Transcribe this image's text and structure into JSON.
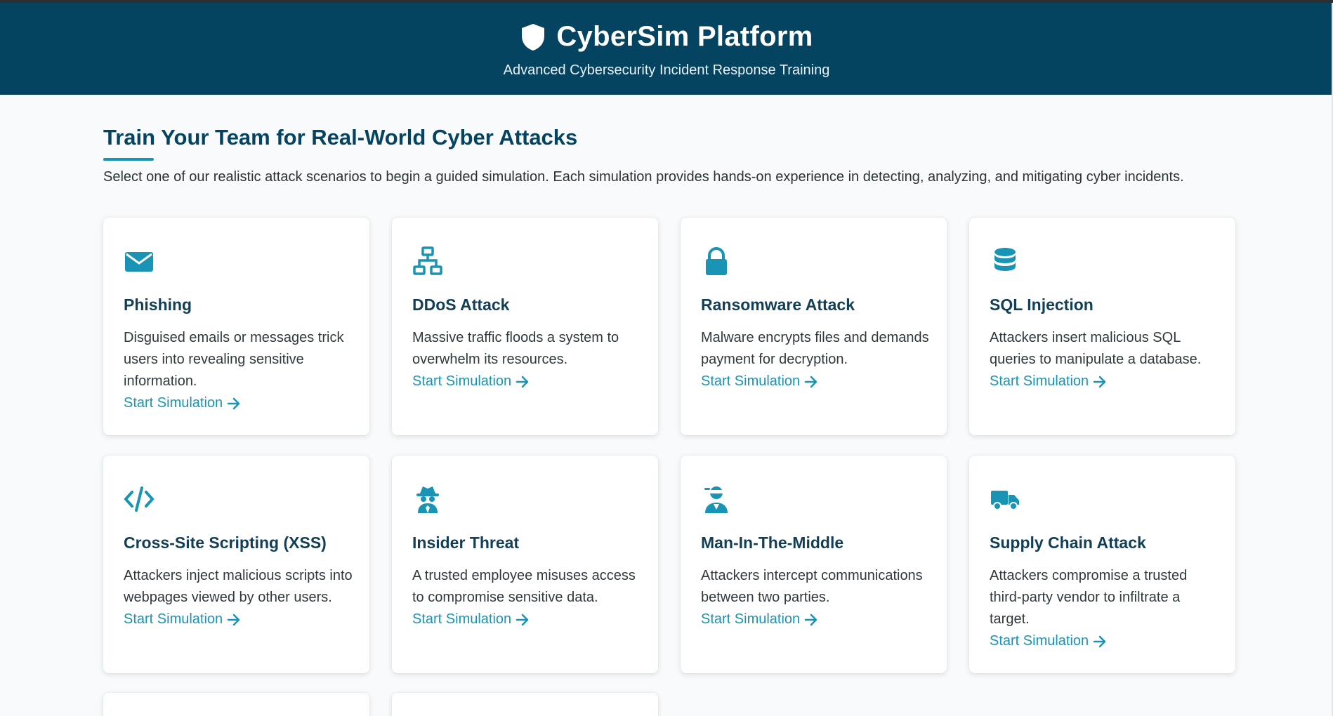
{
  "header": {
    "title": "CyberSim Platform",
    "subtitle": "Advanced Cybersecurity Incident Response Training",
    "logo_icon": "shield-icon"
  },
  "intro": {
    "heading": "Train Your Team for Real-World Cyber Attacks",
    "text": "Select one of our realistic attack scenarios to begin a guided simulation. Each simulation provides hands-on experience in detecting, analyzing, and mitigating cyber incidents."
  },
  "colors": {
    "header_bg": "#054460",
    "accent": "#1a94b4",
    "title": "#123f55"
  },
  "scenarios": [
    {
      "icon": "envelope-icon",
      "title": "Phishing",
      "description": "Disguised emails or messages trick users into revealing sensitive information.",
      "link": "Start Simulation"
    },
    {
      "icon": "network-icon",
      "title": "DDoS Attack",
      "description": "Massive traffic floods a system to overwhelm its resources.",
      "link": "Start Simulation"
    },
    {
      "icon": "lock-icon",
      "title": "Ransomware Attack",
      "description": "Malware encrypts files and demands payment for decryption.",
      "link": "Start Simulation"
    },
    {
      "icon": "database-icon",
      "title": "SQL Injection",
      "description": "Attackers insert malicious SQL queries to manipulate a database.",
      "link": "Start Simulation"
    },
    {
      "icon": "code-icon",
      "title": "Cross-Site Scripting (XSS)",
      "description": "Attackers inject malicious scripts into webpages viewed by other users.",
      "link": "Start Simulation"
    },
    {
      "icon": "spy-icon",
      "title": "Insider Threat",
      "description": "A trusted employee misuses access to compromise sensitive data.",
      "link": "Start Simulation"
    },
    {
      "icon": "masked-user-icon",
      "title": "Man-In-The-Middle",
      "description": "Attackers intercept communications between two parties.",
      "link": "Start Simulation"
    },
    {
      "icon": "truck-icon",
      "title": "Supply Chain Attack",
      "description": "Attackers compromise a trusted third-party vendor to infiltrate a target.",
      "link": "Start Simulation"
    }
  ]
}
